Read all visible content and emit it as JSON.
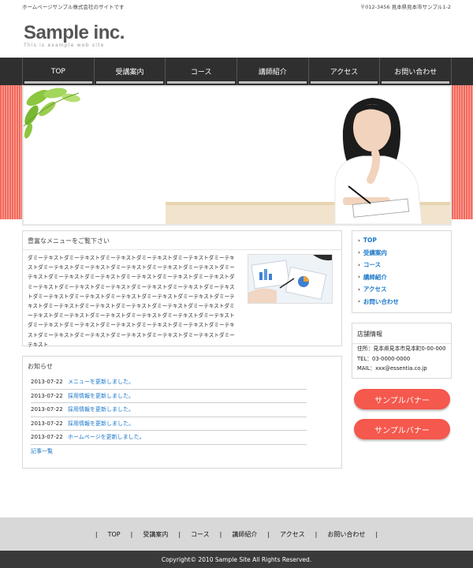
{
  "top": {
    "tagline": "ホームページサンプル株式会社のサイトです",
    "address": "〒012-3456 見本県見本市サンプル1-2"
  },
  "logo": {
    "brand": "Sample inc.",
    "subtitle": "This is example web site"
  },
  "global_nav": {
    "items": [
      "TOP",
      "受講案内",
      "コース",
      "講師紹介",
      "アクセス",
      "お問い合わせ"
    ]
  },
  "menu_box": {
    "title": "豊富なメニューをご覧下さい",
    "body": "ダミーテキストダミーテキストダミーテキストダミーテキストダミーテキストダミーテキストダミーテキストダミーテキストダミーテキストダミーテキストダミーテキストダミーテキストダミーテキストダミーテキストダミーテキストダミーテキストダミーテキストダミーテキストダミーテキストダミーテキストダミーテキストダミーテキストダミーテキストダミーテキストダミーテキストダミーテキストダミーテキストダミーテキストダミーテキストダミーテキストダミーテキストダミーテキストダミーテキストダミーテキストダミーテキストダミーテキストダミーテキストダミーテキストダミーテキストダミーテキストダミーテキストダミーテキストダミーテキストダミーテキストダミーテキストダミーテキストダミーテキストダミーテキストダミーテキストダミーテキストダミーテキストダミーテキスト"
  },
  "news": {
    "title": "お知らせ",
    "items": [
      {
        "date": "2013-07-22",
        "text": "メニューを更新しました。"
      },
      {
        "date": "2013-07-22",
        "text": "採用情報を更新しました。"
      },
      {
        "date": "2013-07-22",
        "text": "採用情報を更新しました。"
      },
      {
        "date": "2013-07-22",
        "text": "採用情報を更新しました。"
      },
      {
        "date": "2013-07-22",
        "text": "ホームページを更新しました。"
      }
    ],
    "more": "記事一覧"
  },
  "side_nav": {
    "items": [
      "TOP",
      "受講案内",
      "コース",
      "講師紹介",
      "アクセス",
      "お問い合わせ"
    ]
  },
  "shop": {
    "title": "店舗情報",
    "address": "住所：見本県見本市見本町0-00-000",
    "tel": "TEL：03-0000-0000",
    "mail": "MAIL：xxx@essentia.co.jp"
  },
  "banners": [
    "サンプルバナー",
    "サンプルバナー"
  ],
  "footer_nav": {
    "items": [
      "TOP",
      "受講案内",
      "コース",
      "講師紹介",
      "アクセス",
      "お問い合わせ"
    ]
  },
  "copyright": "Copyright© 2010 Sample Site All Rights Reserved."
}
